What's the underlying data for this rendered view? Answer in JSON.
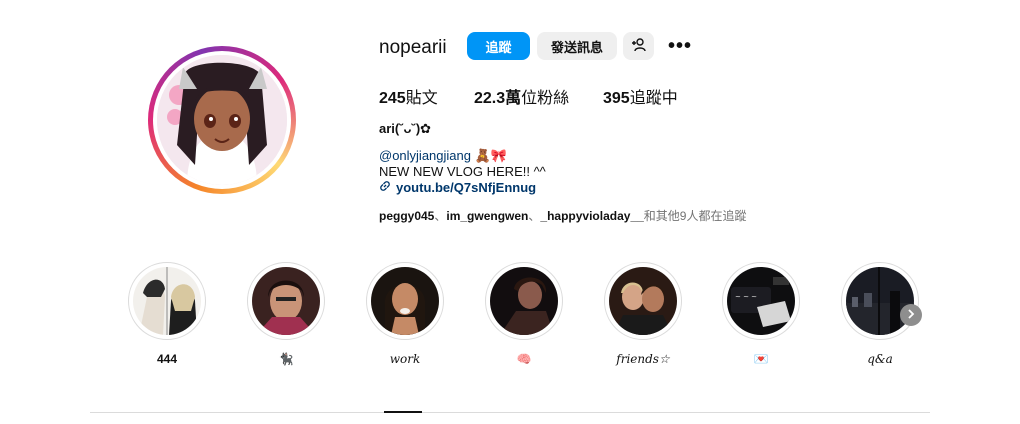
{
  "profile": {
    "username": "nopearii",
    "follow_label": "追蹤",
    "message_label": "發送訊息",
    "posts_count": "245",
    "posts_label": "貼文",
    "followers_count": "22.3萬",
    "followers_label": "位粉絲",
    "following_count": "395",
    "following_label": "追蹤中",
    "full_name": "ari(˘ᴗ˘)✿",
    "bio_mention": "@onlyjiangjiang 🧸🎀",
    "bio_line": "NEW NEW VLOG HERE!! ^^",
    "link": "youtu.be/Q7sNfjEnnug",
    "followed_by": {
      "accounts": [
        "peggy045",
        "im_gwengwen",
        "_happyvioladay__"
      ],
      "separator": "、",
      "suffix": "和其他9人都在追蹤"
    }
  },
  "highlights": [
    {
      "label": "444"
    },
    {
      "label": "🐈‍⬛"
    },
    {
      "label": "work"
    },
    {
      "label": "🧠"
    },
    {
      "label": "friends☆"
    },
    {
      "label": "💌"
    },
    {
      "label": "q&a"
    }
  ],
  "colors": {
    "accent": "#0095f6",
    "link": "#00376b",
    "muted": "#737373",
    "button_bg": "#efefef"
  }
}
